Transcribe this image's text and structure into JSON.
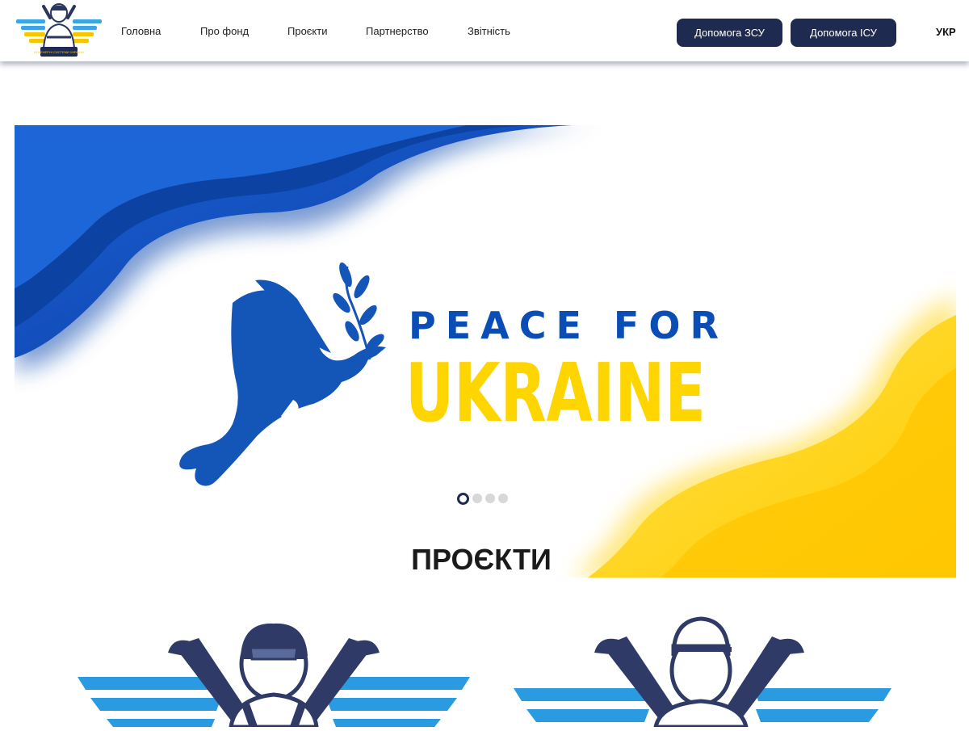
{
  "header": {
    "logo_text": "ІНЖЕНЕРНІ СИСТЕМИ УКРАЇНИ",
    "nav": [
      "Головна",
      "Про фонд",
      "Проєкти",
      "Партнерство",
      "Звітність"
    ],
    "buttons": {
      "help_zsu": "Допомога ЗСУ",
      "help_isu": "Допомога ІСУ"
    },
    "language": "УКР"
  },
  "hero": {
    "line1": "PEACE FOR",
    "line2": "UKRAINE",
    "slides_total": 4,
    "active_slide": 1,
    "colors": {
      "blue": "#0a4db5",
      "yellow": "#ffd500",
      "dove": "#1456b8"
    }
  },
  "projects": {
    "title": "ПРОЄКТИ"
  },
  "colors": {
    "accent": "#1f2a50",
    "wing": "#2a9be0"
  }
}
